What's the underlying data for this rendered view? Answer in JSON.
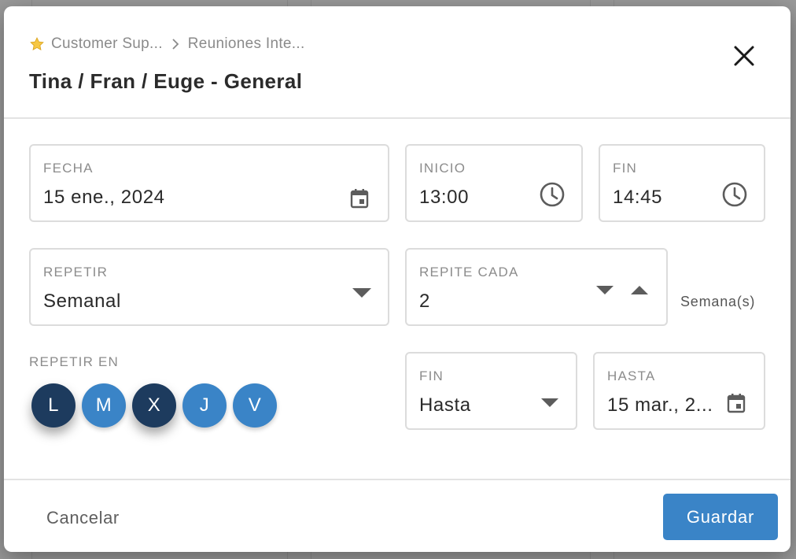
{
  "breadcrumb": {
    "icon": "star-icon",
    "parent": "Customer Sup...",
    "current": "Reuniones Inte..."
  },
  "title": "Tina / Fran / Euge - General",
  "fields": {
    "fecha": {
      "label": "FECHA",
      "value": "15 ene., 2024",
      "icon": "calendar-icon"
    },
    "inicio": {
      "label": "INICIO",
      "value": "13:00",
      "icon": "clock-icon"
    },
    "fin": {
      "label": "FIN",
      "value": "14:45",
      "icon": "clock-icon"
    },
    "repetir": {
      "label": "REPETIR",
      "value": "Semanal",
      "icon": "dropdown-arrow-icon"
    },
    "repite_cada": {
      "label": "REPITE CADA",
      "value": "2",
      "unit": "Semana(s)"
    },
    "fin_repeticion": {
      "label": "FIN",
      "value": "Hasta",
      "icon": "dropdown-arrow-icon"
    },
    "hasta": {
      "label": "HASTA",
      "value": "15 mar., 2...",
      "icon": "calendar-icon"
    }
  },
  "repeat_on": {
    "label": "REPETIR EN",
    "days": [
      {
        "letter": "L",
        "selected": true
      },
      {
        "letter": "M",
        "selected": false
      },
      {
        "letter": "X",
        "selected": true
      },
      {
        "letter": "J",
        "selected": false
      },
      {
        "letter": "V",
        "selected": false
      }
    ]
  },
  "footer": {
    "cancel_label": "Cancelar",
    "save_label": "Guardar"
  },
  "colors": {
    "primary": "#3a84c7",
    "selected_day": "#1d3b5e",
    "unselected_day": "#3a84c7"
  }
}
